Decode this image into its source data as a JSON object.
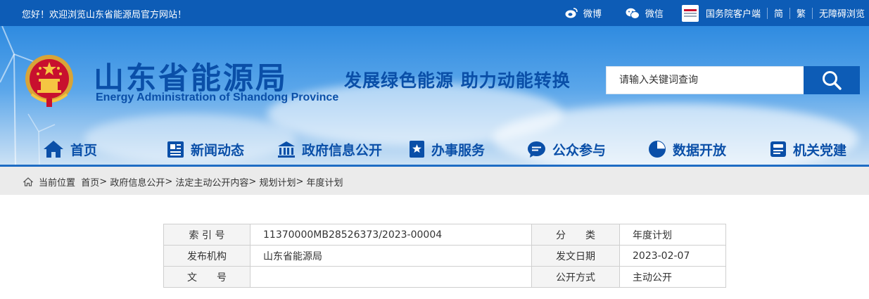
{
  "topbar": {
    "welcome": "您好！欢迎浏览山东省能源局官方网站！",
    "weibo": "微博",
    "weixin": "微信",
    "guowuyuan": "国务院客户端",
    "simplified": "简",
    "traditional": "繁",
    "accessible": "无障碍浏览",
    "bg_color": "#0d5cb6"
  },
  "header": {
    "title_cn": "山东省能源局",
    "title_en": "Energy Administration of Shandong Province",
    "slogan": "发展绿色能源  助力动能转换",
    "brand_color": "#0a4fa8"
  },
  "search": {
    "placeholder": "请输入关键词查询",
    "icon": "search-icon"
  },
  "nav": {
    "items": [
      {
        "label": "首页",
        "icon": "home-icon"
      },
      {
        "label": "新闻动态",
        "icon": "newspaper-icon"
      },
      {
        "label": "政府信息公开",
        "icon": "government-building-icon"
      },
      {
        "label": "办事服务",
        "icon": "bookmark-star-icon"
      },
      {
        "label": "公众参与",
        "icon": "chat-bubble-icon"
      },
      {
        "label": "数据开放",
        "icon": "pie-chart-icon"
      },
      {
        "label": "机关党建",
        "icon": "id-card-icon"
      }
    ]
  },
  "breadcrumb": {
    "prefix": "当前位置",
    "items": [
      "首页",
      "政府信息公开",
      "法定主动公开内容",
      "规划计划",
      "年度计划"
    ],
    "separator": ">"
  },
  "meta": {
    "rows": [
      {
        "label1": "索 引 号",
        "value1": "11370000MB28526373/2023-00004",
        "label2": "分　　类",
        "value2": "年度计划"
      },
      {
        "label1": "发布机构",
        "value1": "山东省能源局",
        "label2": "发文日期",
        "value2": "2023-02-07"
      },
      {
        "label1": "文　　号",
        "value1": "",
        "label2": "公开方式",
        "value2": "主动公开"
      }
    ]
  }
}
